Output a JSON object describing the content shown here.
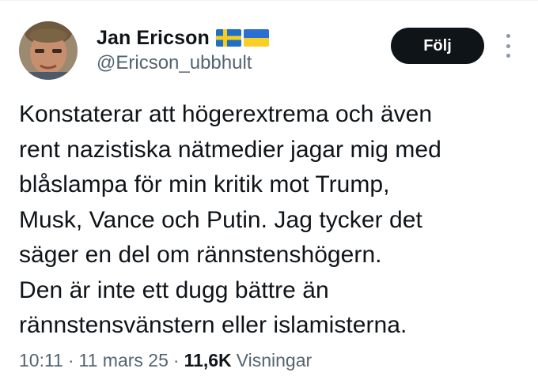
{
  "author": {
    "display_name": "Jan Ericson",
    "handle": "@Ericson_ubbhult",
    "flags": [
      "sweden-flag-icon",
      "ukraine-flag-icon"
    ]
  },
  "follow_button": {
    "label": "Följ"
  },
  "tweet": {
    "lines": [
      "Konstaterar att högerextrema och även",
      "rent nazistiska nätmedier jagar mig med",
      "blåslampa för min kritik mot Trump,",
      "Musk, Vance och Putin. Jag tycker det",
      "säger en del om rännstenshögern.",
      "Den är inte ett dugg bättre än",
      "rännstensvänstern eller islamisterna."
    ]
  },
  "meta": {
    "time": "10:11",
    "separator": "·",
    "date": "11 mars 25",
    "views_count": "11,6K",
    "views_label": "Visningar"
  },
  "colors": {
    "text_primary": "#0f1419",
    "text_secondary": "#536471",
    "button_bg": "#0f1419",
    "button_text": "#ffffff"
  }
}
